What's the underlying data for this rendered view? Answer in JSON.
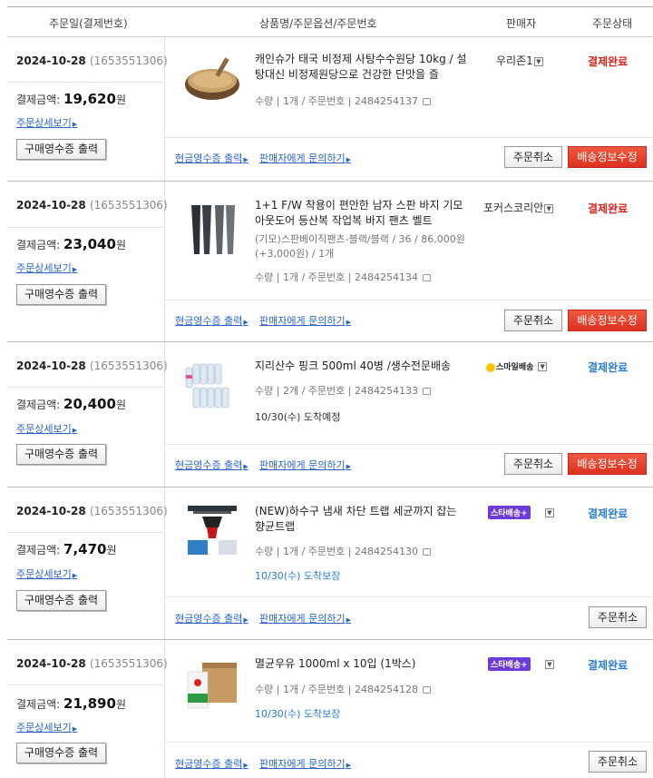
{
  "header": {
    "col_date": "주문일(결제번호)",
    "col_product": "상품명/주문옵션/주문번호",
    "col_seller": "판매자",
    "col_status": "주문상태"
  },
  "common": {
    "payment_label": "결제금액:",
    "currency": "원",
    "detail_link": "주문상세보기",
    "receipt_button": "구매영수증 출력",
    "cash_receipt_link": "현금영수증 출력",
    "ask_seller_link": "판매자에게 문의하기",
    "cancel_button": "주문취소",
    "shipping_edit_button": "배송정보수정",
    "qty_label": "수량",
    "order_no_label": "주문번호"
  },
  "orders": [
    {
      "date": "2024-10-28",
      "payment_no": "(1653551306)",
      "amount": "19,620",
      "product_name": "캐인슈가 태국 비정제 사탕수수원당 10kg / 설탕대신 비정제원당으로 건강한 단맛을 즐",
      "option": "",
      "qty": "1개",
      "order_no": "2484254137",
      "eta": "",
      "seller": "우리존1",
      "seller_type": "text",
      "status": "결제완료",
      "status_color": "#e0201b",
      "image": "brown-sugar-bowl"
    },
    {
      "date": "2024-10-28",
      "payment_no": "(1653551306)",
      "amount": "23,040",
      "product_name": "1+1 F/W 착용이 편안한 남자 스판 바지 기모 아웃도어 등산복 작업복 바지 팬츠 벨트",
      "option": "(기모)스판베이직팬츠-블랙/블랙 / 36 / 86,000원(+3,000원) / 1개",
      "qty": "1개",
      "order_no": "2484254134",
      "eta": "",
      "seller": "포커스코리안",
      "seller_type": "text",
      "status": "결제완료",
      "status_color": "#e0201b",
      "image": "pants"
    },
    {
      "date": "2024-10-28",
      "payment_no": "(1653551306)",
      "amount": "20,400",
      "product_name": "지리산수 핑크 500ml 40병 /생수전문배송",
      "option": "",
      "qty": "2개",
      "order_no": "2484254133",
      "eta": "10/30(수) 도착예정",
      "seller": "스마일배송",
      "seller_type": "smile",
      "status": "결제완료",
      "status_color": "#2a7ed1",
      "image": "water-bottles"
    },
    {
      "date": "2024-10-28",
      "payment_no": "(1653551306)",
      "amount": "7,470",
      "product_name": "(NEW)하수구 냄새 차단 트랩 세균까지 잡는 향균트랩",
      "option": "",
      "qty": "1개",
      "order_no": "2484254130",
      "eta": "10/30(수) 도착보장",
      "seller": "스타배송+",
      "seller_type": "star",
      "status": "결제완료",
      "status_color": "#2a7ed1",
      "image": "drain-trap"
    },
    {
      "date": "2024-10-28",
      "payment_no": "(1653551306)",
      "amount": "21,890",
      "product_name": "멸균우유 1000ml x 10입 (1박스)",
      "option": "",
      "qty": "1개",
      "order_no": "2484254128",
      "eta": "10/30(수) 도착보장",
      "seller": "스타배송+",
      "seller_type": "star",
      "status": "결제완료",
      "status_color": "#2a7ed1",
      "image": "milk-box"
    }
  ]
}
